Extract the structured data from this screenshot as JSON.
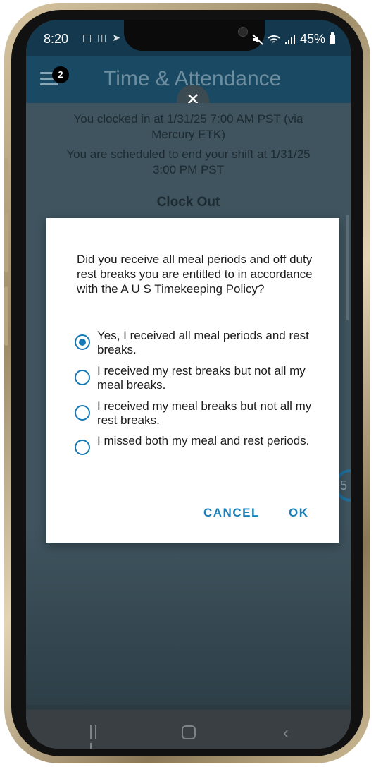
{
  "status_bar": {
    "time": "8:20",
    "left_icons": "◫ ◫ ➤ •",
    "battery": "45%"
  },
  "app_bar": {
    "title": "Time & Attendance",
    "notification_count": "2",
    "close_symbol": "✕"
  },
  "background_info": {
    "clocked_in_line1": "You clocked in at 1/31/25 7:00 AM PST (via",
    "clocked_in_line2": "Mercury ETK)",
    "scheduled_line1": "You are scheduled to end your shift at 1/31/25",
    "scheduled_line2": "3:00 PM PST",
    "clock_out_heading": "Clock Out",
    "ring_value": "5"
  },
  "dialog": {
    "question": "Did you receive all meal periods and off duty rest breaks you are entitled to in accordance with the A U S Timekeeping Policy?",
    "options": [
      {
        "label": "Yes, I received all meal periods and rest breaks.",
        "selected": true
      },
      {
        "label": "I received my rest breaks but not all my meal breaks.",
        "selected": false
      },
      {
        "label": "I received my meal breaks but not all my rest breaks.",
        "selected": false
      },
      {
        "label": "I missed both my meal and rest periods.",
        "selected": false
      }
    ],
    "cancel_label": "CANCEL",
    "ok_label": "OK"
  },
  "colors": {
    "accent": "#1579b6",
    "app_bar": "#1a4a63",
    "status_bar": "#14394e"
  }
}
